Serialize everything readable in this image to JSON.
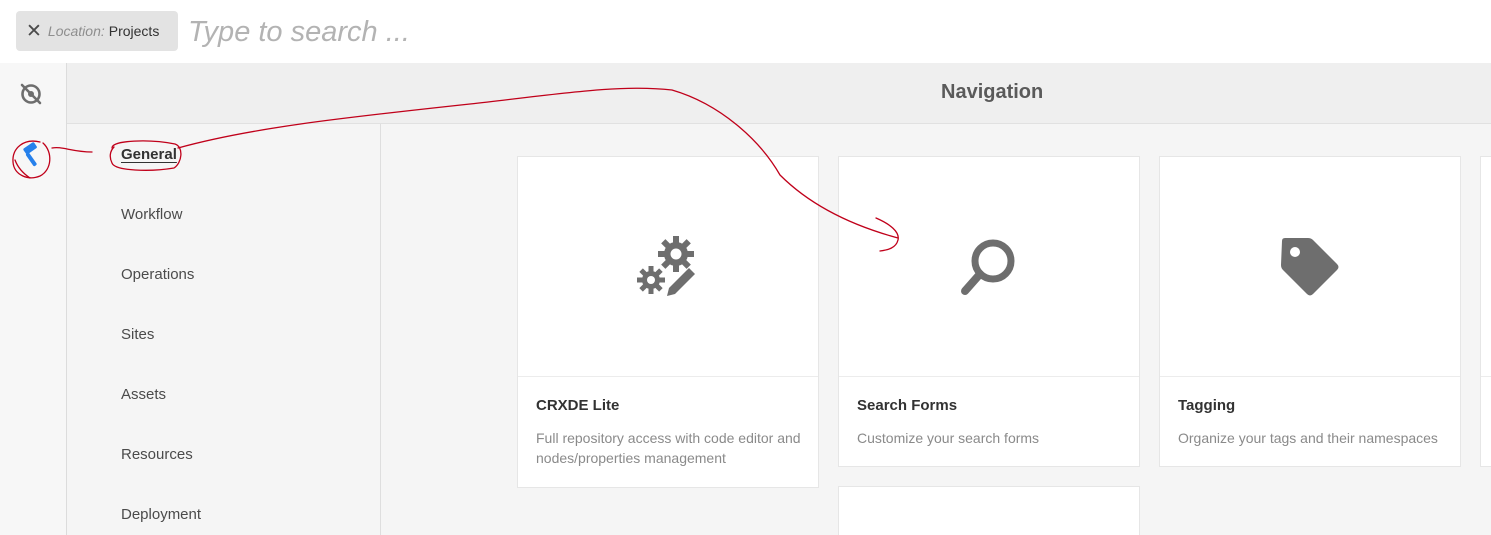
{
  "search": {
    "location_key": "Location:",
    "location_value": "Projects",
    "placeholder": "Type to search ..."
  },
  "rail": {
    "items": [
      {
        "icon": "compass-off-icon"
      },
      {
        "icon": "hammer-icon",
        "active": true
      }
    ]
  },
  "header": {
    "title": "Navigation"
  },
  "categories": [
    {
      "label": "General",
      "active": true
    },
    {
      "label": "Workflow"
    },
    {
      "label": "Operations"
    },
    {
      "label": "Sites"
    },
    {
      "label": "Assets"
    },
    {
      "label": "Resources"
    },
    {
      "label": "Deployment"
    }
  ],
  "cards": [
    {
      "title": "CRXDE Lite",
      "description": "Full repository access with code editor and nodes/properties management",
      "icon": "gears-pencil-icon"
    },
    {
      "title": "Search Forms",
      "description": "Customize your search forms",
      "icon": "magnifier-icon"
    },
    {
      "title": "Tagging",
      "description": "Organize your tags and their namespaces",
      "icon": "tag-icon"
    }
  ],
  "colors": {
    "accent": "#2680eb",
    "annotation": "#c0001a",
    "icon_gray": "#6e6e6e"
  }
}
